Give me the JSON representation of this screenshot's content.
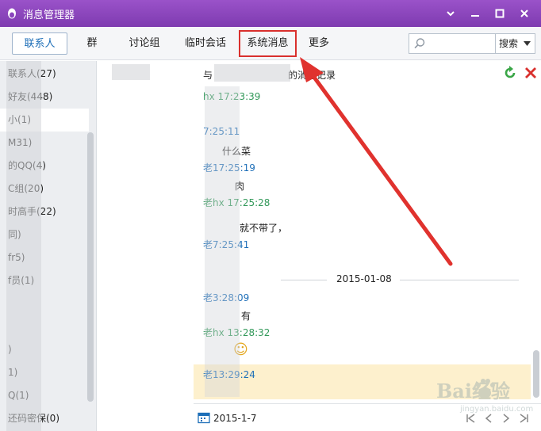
{
  "window": {
    "title": "消息管理器"
  },
  "nav": {
    "tabs": [
      {
        "label": "联系人",
        "active": true
      },
      {
        "label": "群"
      },
      {
        "label": "讨论组"
      },
      {
        "label": "临时会话"
      },
      {
        "label": "系统消息",
        "highlighted": true
      },
      {
        "label": "更多"
      }
    ],
    "search_placeholder": "",
    "search_button": "搜索"
  },
  "groups": [
    {
      "label": "联系人(27)"
    },
    {
      "label": "好友(448)"
    },
    {
      "label": "小(1)"
    },
    {
      "label": "M31)"
    },
    {
      "label": "的QQ(4)"
    },
    {
      "label": "C组(20)"
    },
    {
      "label": "时高手(22)"
    },
    {
      "label": "同)"
    },
    {
      "label": "fr5)"
    },
    {
      "label": "f员(1)"
    },
    {
      "label": ""
    },
    {
      "label": ""
    },
    {
      "label": ")"
    },
    {
      "label": "1)"
    },
    {
      "label": "Q(1)"
    },
    {
      "label": "还码密保(0)"
    }
  ],
  "chat": {
    "header_prefix": "与",
    "header_suffix": "的消息记录",
    "messages": [
      {
        "meta": "hx 17:23:39",
        "color": "green"
      },
      {
        "meta": "7:25:11",
        "color": "blue",
        "text": "什么菜"
      },
      {
        "meta": "老17:25:19",
        "color": "blue",
        "text": "肉"
      },
      {
        "meta": "老hx 17:25:28",
        "color": "green",
        "text": "就不带了，"
      },
      {
        "meta": "老7:25:41",
        "color": "blue"
      },
      {
        "meta": "老3:28:09",
        "color": "blue",
        "text": "有"
      },
      {
        "meta": "老hx 13:28:32",
        "color": "green"
      },
      {
        "meta": "老13:29:24",
        "color": "blue"
      }
    ],
    "date_separator": "2015-01-08",
    "emoji": "☺"
  },
  "bottom": {
    "date": "2015-1-7"
  },
  "watermark": {
    "brand": "Bai经验",
    "url": "jingyan.baidu.com"
  },
  "colors": {
    "titlebar": "#8a45bd",
    "accent_blue": "#1e6fb8",
    "accent_green": "#33995a",
    "annotation_red": "#d9302d",
    "highlight_row": "#fdf0cd"
  }
}
